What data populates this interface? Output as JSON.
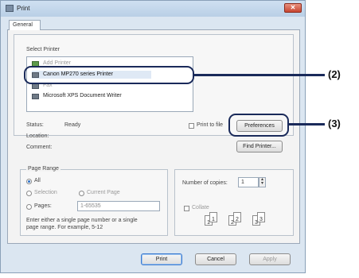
{
  "window": {
    "title": "Print",
    "close_label": "✕"
  },
  "tabs": [
    {
      "label": "General"
    }
  ],
  "select_printer": {
    "label": "Select Printer",
    "printers": [
      {
        "name": "Add Printer",
        "selected": false
      },
      {
        "name": "Canon MP270 series Printer",
        "selected": true
      },
      {
        "name": "Fax",
        "selected": false
      },
      {
        "name": "Microsoft XPS Document Writer",
        "selected": false
      }
    ]
  },
  "status": {
    "status_label": "Status:",
    "status_value": "Ready",
    "location_label": "Location:",
    "location_value": "",
    "comment_label": "Comment:",
    "comment_value": ""
  },
  "print_to_file": {
    "label": "Print to file",
    "checked": false
  },
  "buttons": {
    "preferences": "Preferences",
    "find_printer": "Find Printer...",
    "print": "Print",
    "cancel": "Cancel",
    "apply": "Apply"
  },
  "page_range": {
    "label": "Page Range",
    "all": "All",
    "selection": "Selection",
    "current_page": "Current Page",
    "pages": "Pages:",
    "pages_value": "1-65535",
    "help_line1": "Enter either a single page number or a single",
    "help_line2": "page range.  For example, 5-12",
    "selected": "All"
  },
  "copies": {
    "label": "Number of copies:",
    "value": "1",
    "collate_label": "Collate",
    "collate_checked": false,
    "collate_pages": [
      "1",
      "1",
      "2",
      "2",
      "3",
      "3"
    ]
  },
  "callouts": {
    "printer": "(2)",
    "preferences": "(3)"
  },
  "colors": {
    "callout": "#1a2a5a",
    "accent": "#2b6fc5"
  }
}
